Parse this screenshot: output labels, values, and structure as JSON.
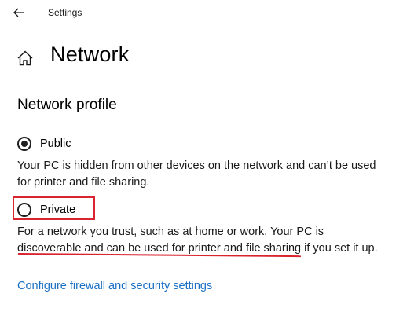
{
  "window": {
    "app_title": "Settings",
    "back_icon": "back-arrow-icon"
  },
  "header": {
    "home_icon": "home-icon",
    "title": "Network"
  },
  "network_profile": {
    "section_title": "Network profile",
    "options": [
      {
        "label": "Public",
        "selected": true,
        "description": "Your PC is hidden from other devices on the network and can’t be used for printer and file sharing."
      },
      {
        "label": "Private",
        "selected": false,
        "description": "For a network you trust, such as at home or work. Your PC is discoverable and can be used for printer and file sharing if you set it up."
      }
    ],
    "link": "Configure firewall and security settings"
  },
  "colors": {
    "link": "#1a6fc4",
    "annotation": "#d9232e"
  }
}
